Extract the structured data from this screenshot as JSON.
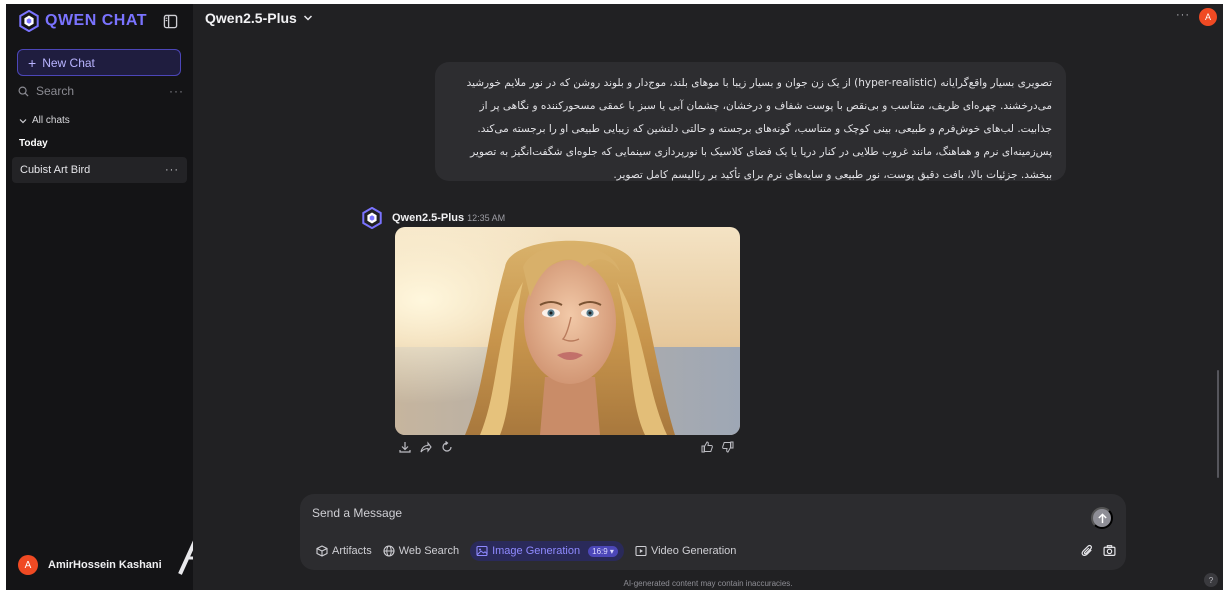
{
  "sidebar": {
    "logo_text": "QWEN CHAT",
    "new_chat_label": "New Chat",
    "search_label": "Search",
    "more_dots": "···",
    "all_chats_label": "All chats",
    "today_label": "Today",
    "chats": [
      {
        "title": "Cubist Art Bird"
      }
    ],
    "user": {
      "initial": "A",
      "name": "AmirHossein Kashani"
    }
  },
  "header": {
    "model_name": "Qwen2.5-Plus",
    "more_dots": "···",
    "avatar_initial": "A"
  },
  "conversation": {
    "user_message": "تصویری بسیار واقع‌گرایانه (hyper-realistic) از یک زن جوان و بسیار زیبا با موهای بلند، موج‌دار و بلوند روشن که در نور ملایم خورشید می‌درخشند. چهره‌ای ظریف، متناسب و بی‌نقص با پوست شفاف و درخشان، چشمان آبی یا سبز با عمقی مسحورکننده و نگاهی پر از جذابیت. لب‌های خوش‌فرم و طبیعی، بینی کوچک و متناسب، گونه‌های برجسته و حالتی دلنشین که زیبایی طبیعی او را برجسته می‌کند. پس‌زمینه‌ای نرم و هماهنگ، مانند غروب طلایی در کنار دریا یا یک فضای کلاسیک با نورپردازی سینمایی که جلوه‌ای شگفت‌انگیز به تصویر ببخشد. جزئیات بالا، بافت دقیق پوست، نور طبیعی و سایه‌های نرم برای تأکید بر رئالیسم کامل تصویر.",
    "bot": {
      "name": "Qwen2.5-Plus",
      "time": "12:35 AM"
    }
  },
  "composer": {
    "placeholder": "Send a Message",
    "tools": {
      "artifacts": "Artifacts",
      "web_search": "Web Search",
      "image_generation": "Image Generation",
      "ratio": "16:9",
      "video_generation": "Video Generation"
    }
  },
  "footer": {
    "disclaimer": "AI-generated content may contain inaccuracies.",
    "help": "?"
  },
  "colors": {
    "accent": "#7a73ff",
    "sidebar_bg": "#141416",
    "main_bg": "#212123",
    "avatar": "#f04a23"
  }
}
